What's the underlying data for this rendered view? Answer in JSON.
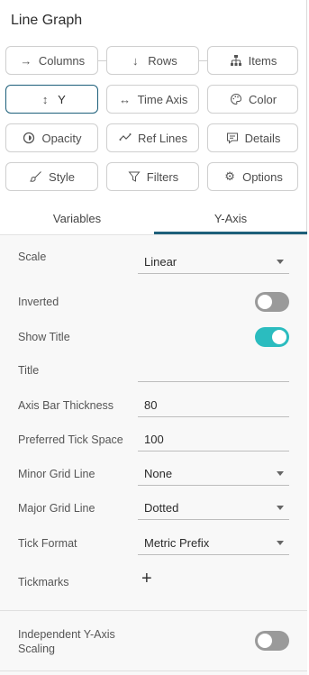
{
  "header": {
    "title": "Line Graph"
  },
  "buttons": {
    "columns": "Columns",
    "rows": "Rows",
    "items": "Items",
    "y": "Y",
    "time_axis": "Time Axis",
    "color": "Color",
    "opacity": "Opacity",
    "ref_lines": "Ref Lines",
    "details": "Details",
    "style": "Style",
    "filters": "Filters",
    "options": "Options"
  },
  "tabs": {
    "variables": "Variables",
    "y_axis": "Y-Axis",
    "active": "Y-Axis"
  },
  "settings": {
    "scale": {
      "label": "Scale",
      "value": "Linear"
    },
    "inverted": {
      "label": "Inverted",
      "on": false
    },
    "show_title": {
      "label": "Show Title",
      "on": true
    },
    "title": {
      "label": "Title",
      "value": ""
    },
    "axis_bar_thickness": {
      "label": "Axis Bar Thickness",
      "value": "80"
    },
    "preferred_tick_space": {
      "label": "Preferred Tick Space",
      "value": "100"
    },
    "minor_grid_line": {
      "label": "Minor Grid Line",
      "value": "None"
    },
    "major_grid_line": {
      "label": "Major Grid Line",
      "value": "Dotted"
    },
    "tick_format": {
      "label": "Tick Format",
      "value": "Metric Prefix"
    },
    "tickmarks": {
      "label": "Tickmarks"
    },
    "independent_scaling": {
      "label_line1": "Independent Y-Axis",
      "label_line2": "Scaling",
      "on": false
    }
  },
  "colors": {
    "accent": "#1d5f7a",
    "toggle_on": "#2bbcbf",
    "toggle_off": "#9a9a9a"
  },
  "icons": {
    "columns": "arrow-right-icon",
    "rows": "arrow-down-icon",
    "items": "hierarchy-icon",
    "y": "vertical-arrows-icon",
    "time_axis": "horizontal-arrows-icon",
    "color": "palette-icon",
    "opacity": "opacity-icon",
    "ref_lines": "ref-lines-icon",
    "details": "details-icon",
    "style": "brush-icon",
    "filters": "filter-icon",
    "options": "gear-icon",
    "tickmarks": "plus-icon"
  }
}
